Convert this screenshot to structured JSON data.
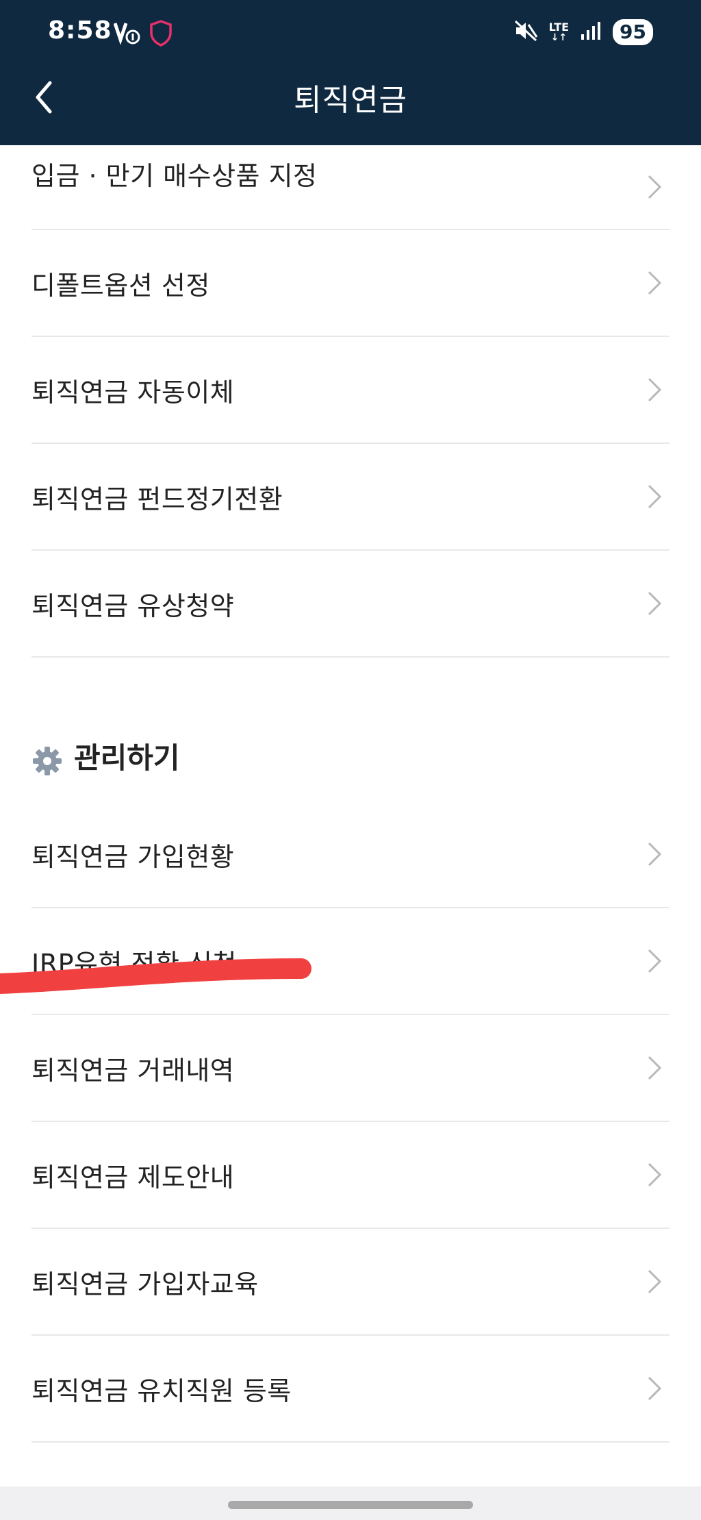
{
  "status_bar": {
    "time": "8:58",
    "battery": "95",
    "network": "LTE"
  },
  "header": {
    "title": "퇴직연금"
  },
  "menu_top": [
    {
      "label": "입금 · 만기 매수상품 지정"
    },
    {
      "label": "디폴트옵션 선정"
    },
    {
      "label": "퇴직연금 자동이체"
    },
    {
      "label": "퇴직연금 펀드정기전환"
    },
    {
      "label": "퇴직연금 유상청약"
    }
  ],
  "section_manage": {
    "title": "관리하기",
    "icon": "gear-icon"
  },
  "menu_manage": [
    {
      "label": "퇴직연금 가입현황"
    },
    {
      "label": "IRP유형 전환 신청"
    },
    {
      "label": "퇴직연금 거래내역"
    },
    {
      "label": "퇴직연금 제도안내"
    },
    {
      "label": "퇴직연금 가입자교육"
    },
    {
      "label": "퇴직연금 유치직원 등록"
    }
  ],
  "colors": {
    "header_bg": "#0f2940",
    "annotation_red": "#f04040",
    "gear": "#8a98a8"
  }
}
